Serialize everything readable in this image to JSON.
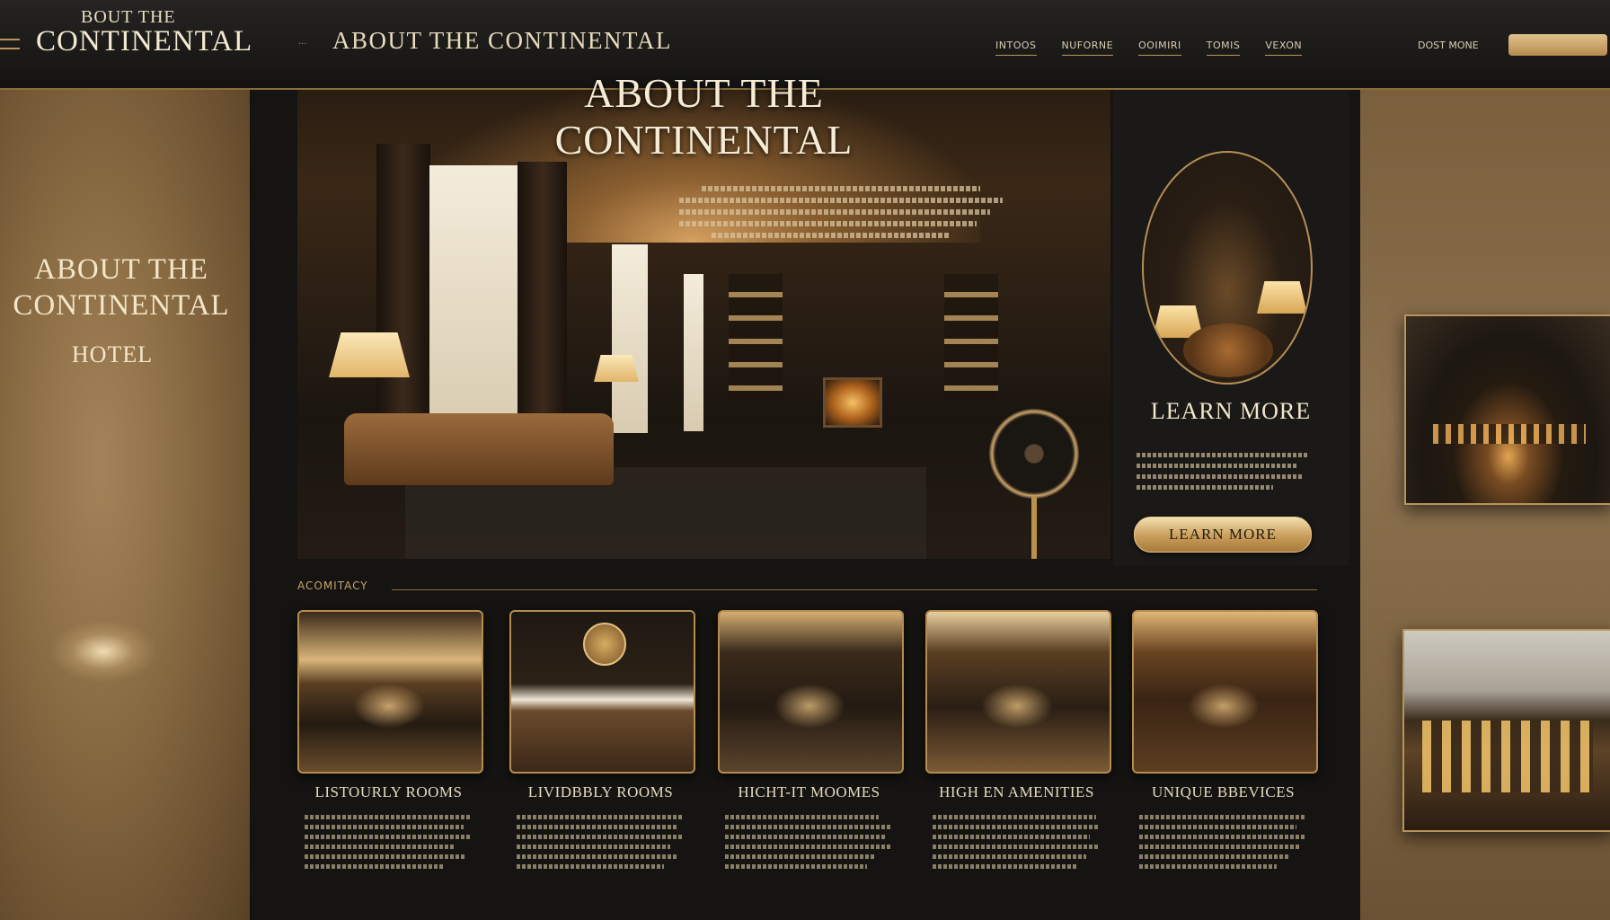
{
  "header": {
    "logo_small": "BOUT THE",
    "logo_big": "CONTINENTAL",
    "nav_prefix": "···",
    "page_title": "ABOUT THE CONTINENTAL",
    "nav_links": [
      "INTOOS",
      "NUFORNE",
      "OOIMIRI",
      "TOMIS",
      "VEXON"
    ],
    "sign_in": "DOST MONE"
  },
  "left_panel": {
    "title_line1": "ABOUT THE",
    "title_line2": "CONTINENTAL",
    "subtitle": "HOTEL"
  },
  "hero": {
    "title_line1": "ABOUT THE",
    "title_line2": "CONTINENTAL"
  },
  "side_panel": {
    "heading": "LEARN MORE",
    "button_label": "LEARN MORE"
  },
  "section": {
    "label": "ACOMITACY"
  },
  "cards": [
    {
      "title": "LISTOURLY ROOMS"
    },
    {
      "title": "LIVIDBBLY ROOMS"
    },
    {
      "title": "HICHT-IT MOOMES"
    },
    {
      "title": "HIGH EN AMENITIES"
    },
    {
      "title": "UNIQUE BBEVICES"
    }
  ],
  "colors": {
    "accent_gold": "#c9a15e",
    "background_dark": "#151412",
    "text_cream": "#f3e7cc"
  }
}
